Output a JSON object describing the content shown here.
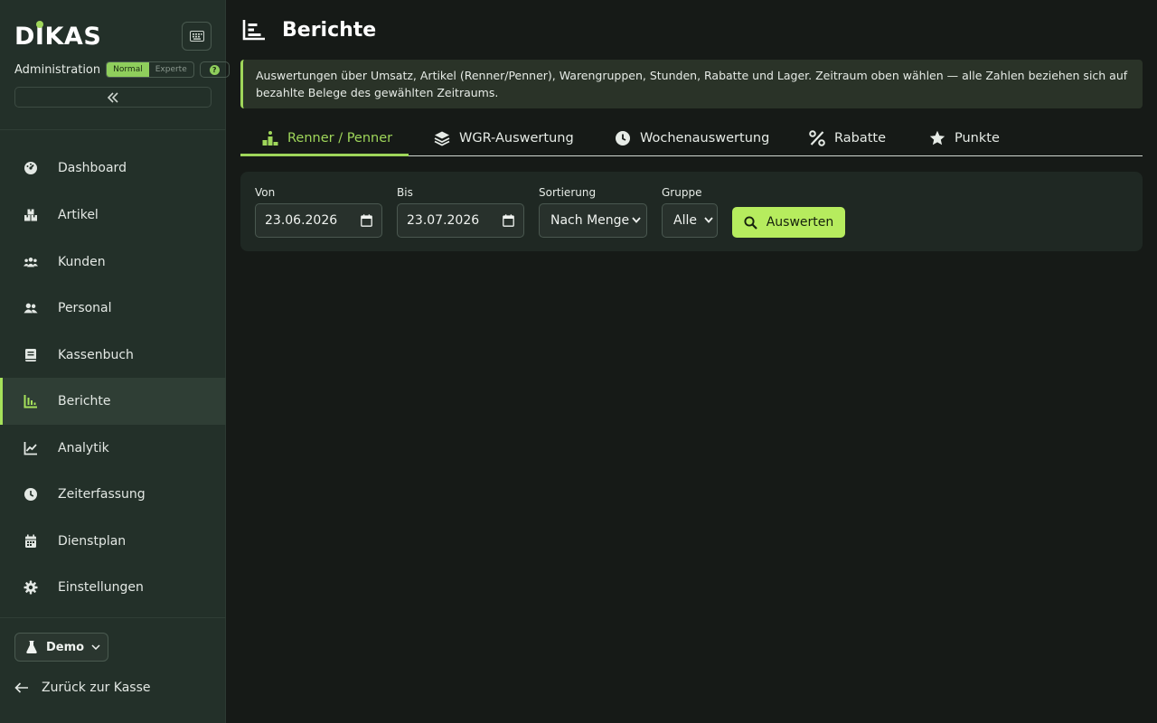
{
  "sidebar": {
    "logo_text": "DIKAS",
    "admin_label": "Administration",
    "mode_options": [
      "Normal",
      "Experte"
    ],
    "help_label": "?",
    "collapse_label": "«",
    "nav_items": [
      {
        "label": "Dashboard",
        "icon": "gauge-icon"
      },
      {
        "label": "Artikel",
        "icon": "boxes-icon"
      },
      {
        "label": "Kunden",
        "icon": "users-icon"
      },
      {
        "label": "Personal",
        "icon": "user-group-icon"
      },
      {
        "label": "Kassenbuch",
        "icon": "book-icon"
      },
      {
        "label": "Berichte",
        "icon": "chart-bars-icon",
        "active": true
      },
      {
        "label": "Analytik",
        "icon": "line-chart-icon"
      },
      {
        "label": "Zeiterfassung",
        "icon": "clock-icon"
      },
      {
        "label": "Dienstplan",
        "icon": "calendar-icon"
      },
      {
        "label": "Einstellungen",
        "icon": "gear-icon"
      }
    ],
    "env_label": "Demo",
    "back_label": "Zurück zur Kasse"
  },
  "header": {
    "title": "Berichte"
  },
  "info": {
    "text": "Auswertungen über Umsatz, Artikel (Renner/Penner), Warengruppen, Stunden, Rabatte und Lager. Zeitraum oben wählen — alle Zahlen beziehen sich auf bezahlte Belege des gewählten Zeitraums."
  },
  "tabs": [
    {
      "label": "Renner / Penner",
      "icon": "podium-icon",
      "active": true
    },
    {
      "label": "WGR-Auswertung",
      "icon": "layers-icon"
    },
    {
      "label": "Wochenauswertung",
      "icon": "clock-icon"
    },
    {
      "label": "Rabatte",
      "icon": "percent-icon"
    },
    {
      "label": "Punkte",
      "icon": "star-icon"
    }
  ],
  "filters": {
    "from_label": "Von",
    "from_value": "23.06.2026",
    "to_label": "Bis",
    "to_value": "23.07.2026",
    "sort_label": "Sortierung",
    "sort_value": "Nach Menge",
    "group_label": "Gruppe",
    "group_value": "Alle",
    "submit_label": "Auswerten"
  },
  "colors": {
    "accent": "#9fd65a",
    "button": "#b6ec5e",
    "sidebar_bg": "#233029",
    "main_bg": "#161a17"
  }
}
